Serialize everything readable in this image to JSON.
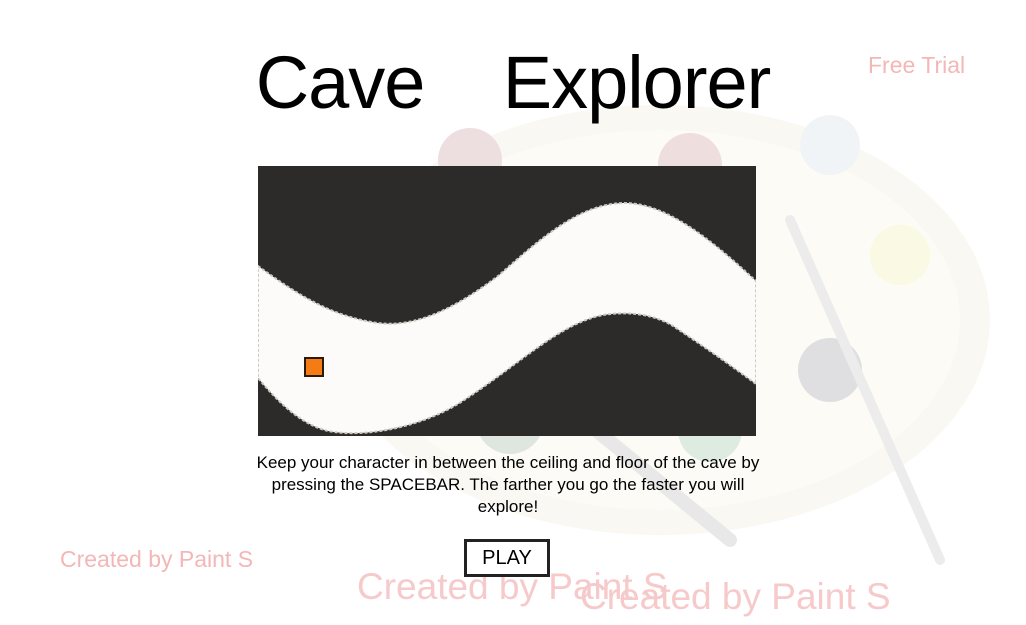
{
  "title": {
    "word1": "Cave",
    "word2": "Explorer"
  },
  "instructions": "Keep your character in between the ceiling and floor of the cave by pressing the SPACEBAR. The farther you go the faster you will explore!",
  "play_button_label": "PLAY",
  "watermarks": {
    "free_trial": "Free Trial",
    "created_by": "Created by Paint S"
  },
  "colors": {
    "cave_wall": "#2d2b29",
    "cave_tunnel": "#fcfbf9",
    "player": "#f57c14",
    "watermark_text": "#f3b7b7"
  },
  "icons": {
    "player": "orange-square",
    "watermark_art": "paint-palette"
  }
}
